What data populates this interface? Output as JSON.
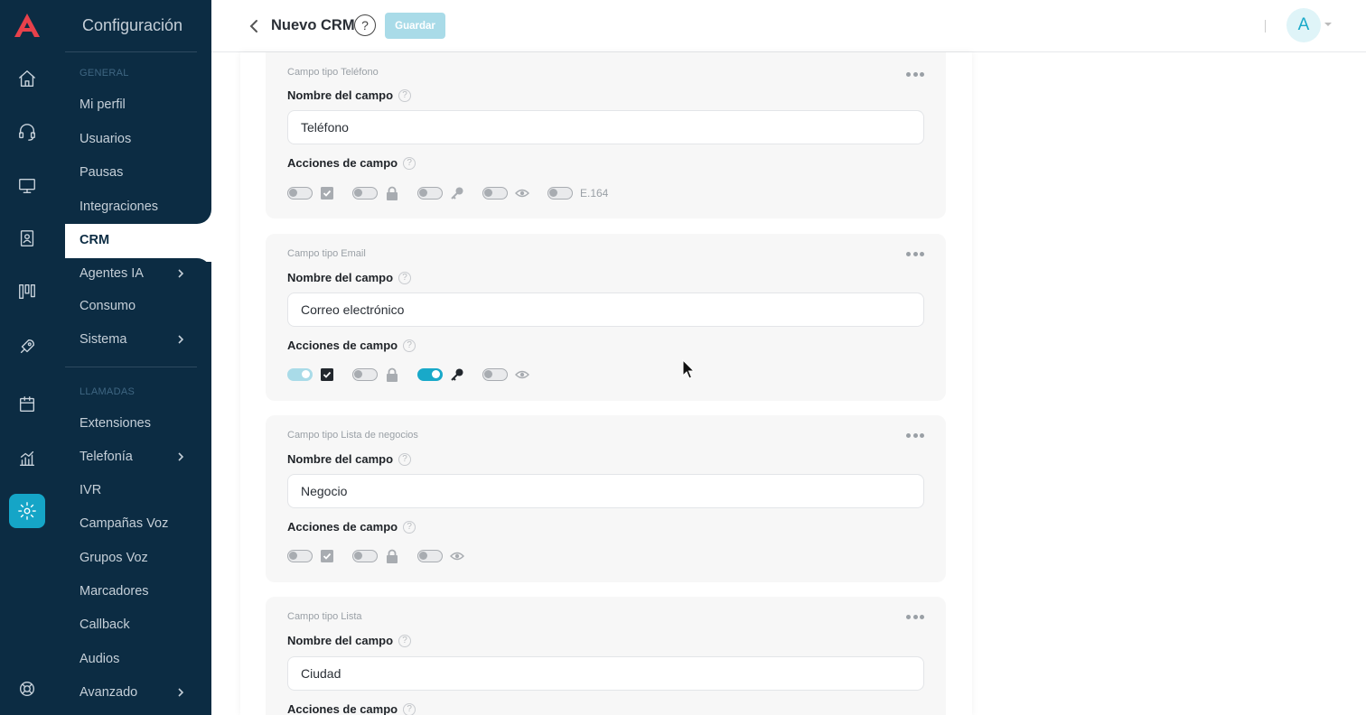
{
  "sidebar": {
    "title": "Configuración",
    "section_general": "GENERAL",
    "section_calls": "LLAMADAS",
    "items": [
      {
        "label": "Mi perfil"
      },
      {
        "label": "Usuarios"
      },
      {
        "label": "Pausas"
      },
      {
        "label": "Integraciones"
      },
      {
        "label": "CRM"
      },
      {
        "label": "Agentes IA"
      },
      {
        "label": "Consumo"
      },
      {
        "label": "Sistema"
      },
      {
        "label": "Extensiones"
      },
      {
        "label": "Telefonía"
      },
      {
        "label": "IVR"
      },
      {
        "label": "Campañas Voz"
      },
      {
        "label": "Grupos Voz"
      },
      {
        "label": "Marcadores"
      },
      {
        "label": "Callback"
      },
      {
        "label": "Audios"
      },
      {
        "label": "Avanzado"
      }
    ]
  },
  "header": {
    "title": "Nuevo CRM",
    "help": "?",
    "save": "Guardar",
    "avatar": "A"
  },
  "common": {
    "field_name_label": "Nombre del campo",
    "field_actions_label": "Acciones de campo",
    "help_mark": "?"
  },
  "cards": [
    {
      "type": "Campo tipo Teléfono",
      "value": "Teléfono",
      "extra": "E.164"
    },
    {
      "type": "Campo tipo Email",
      "value": "Correo electrónico"
    },
    {
      "type": "Campo tipo Lista de negocios",
      "value": "Negocio"
    },
    {
      "type": "Campo tipo Lista",
      "value": "Ciudad"
    }
  ],
  "colors": {
    "navy": "#0c2c43",
    "accent": "#19a9c9",
    "accent_light": "#a9dbe8"
  }
}
